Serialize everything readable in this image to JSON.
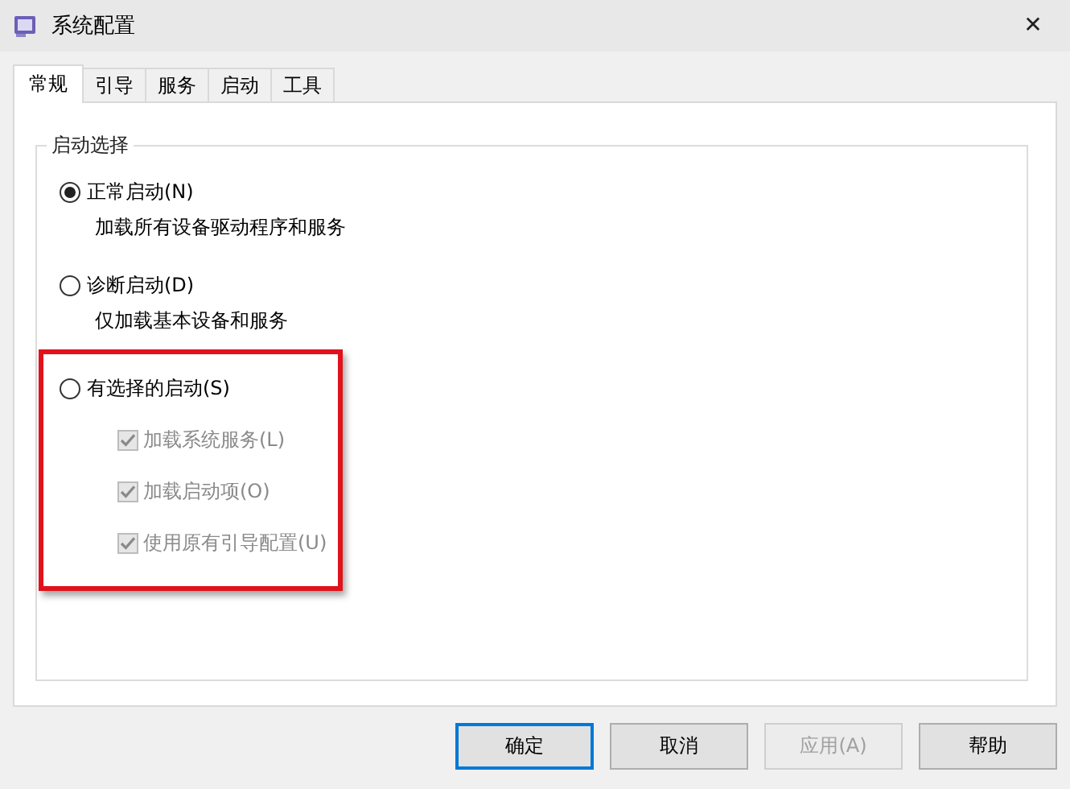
{
  "window": {
    "title": "系统配置",
    "close": "✕"
  },
  "tabs": [
    {
      "label": "常规",
      "selected": true
    },
    {
      "label": "引导",
      "selected": false
    },
    {
      "label": "服务",
      "selected": false
    },
    {
      "label": "启动",
      "selected": false
    },
    {
      "label": "工具",
      "selected": false
    }
  ],
  "group": {
    "title": "启动选择",
    "options": [
      {
        "label": "正常启动(N)",
        "selected": true,
        "highlighted": false,
        "description": "加载所有设备驱动程序和服务"
      },
      {
        "label": "诊断启动(D)",
        "selected": false,
        "highlighted": false,
        "description": "仅加载基本设备和服务"
      },
      {
        "label": "有选择的启动(S)",
        "selected": false,
        "highlighted": true,
        "children": [
          {
            "label": "加载系统服务(L)",
            "checked": true,
            "disabled": true
          },
          {
            "label": "加载启动项(O)",
            "checked": true,
            "disabled": true
          },
          {
            "label": "使用原有引导配置(U)",
            "checked": true,
            "disabled": true
          }
        ]
      }
    ]
  },
  "buttons": [
    {
      "label": "确定",
      "default": true,
      "disabled": false
    },
    {
      "label": "取消",
      "default": false,
      "disabled": false
    },
    {
      "label": "应用(A)",
      "default": false,
      "disabled": true
    },
    {
      "label": "帮助",
      "default": false,
      "disabled": false
    }
  ]
}
